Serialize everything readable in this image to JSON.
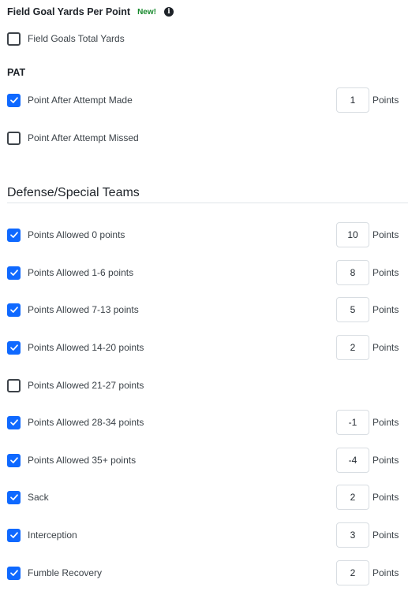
{
  "field_goal_section": {
    "title": "Field Goal Yards Per Point",
    "badge": "New!",
    "info_icon": "info-icon",
    "items": [
      {
        "label": "Field Goals Total Yards",
        "checked": false
      }
    ]
  },
  "pat_section": {
    "title": "PAT",
    "items": [
      {
        "label": "Point After Attempt Made",
        "checked": true,
        "points": "1",
        "unit": "Points"
      },
      {
        "label": "Point After Attempt Missed",
        "checked": false
      }
    ]
  },
  "defense_section": {
    "title": "Defense/Special Teams",
    "items": [
      {
        "label": "Points Allowed 0 points",
        "checked": true,
        "points": "10",
        "unit": "Points"
      },
      {
        "label": "Points Allowed 1-6 points",
        "checked": true,
        "points": "8",
        "unit": "Points"
      },
      {
        "label": "Points Allowed 7-13 points",
        "checked": true,
        "points": "5",
        "unit": "Points"
      },
      {
        "label": "Points Allowed 14-20 points",
        "checked": true,
        "points": "2",
        "unit": "Points"
      },
      {
        "label": "Points Allowed 21-27 points",
        "checked": false
      },
      {
        "label": "Points Allowed 28-34 points",
        "checked": true,
        "points": "-1",
        "unit": "Points"
      },
      {
        "label": "Points Allowed 35+ points",
        "checked": true,
        "points": "-4",
        "unit": "Points"
      },
      {
        "label": "Sack",
        "checked": true,
        "points": "2",
        "unit": "Points"
      },
      {
        "label": "Interception",
        "checked": true,
        "points": "3",
        "unit": "Points"
      },
      {
        "label": "Fumble Recovery",
        "checked": true,
        "points": "2",
        "unit": "Points"
      }
    ]
  },
  "colors": {
    "checkbox_checked": "#0f69ff",
    "badge_green": "#188a2e"
  },
  "icons": {
    "check": "checkmark-icon",
    "info": "info-icon"
  }
}
